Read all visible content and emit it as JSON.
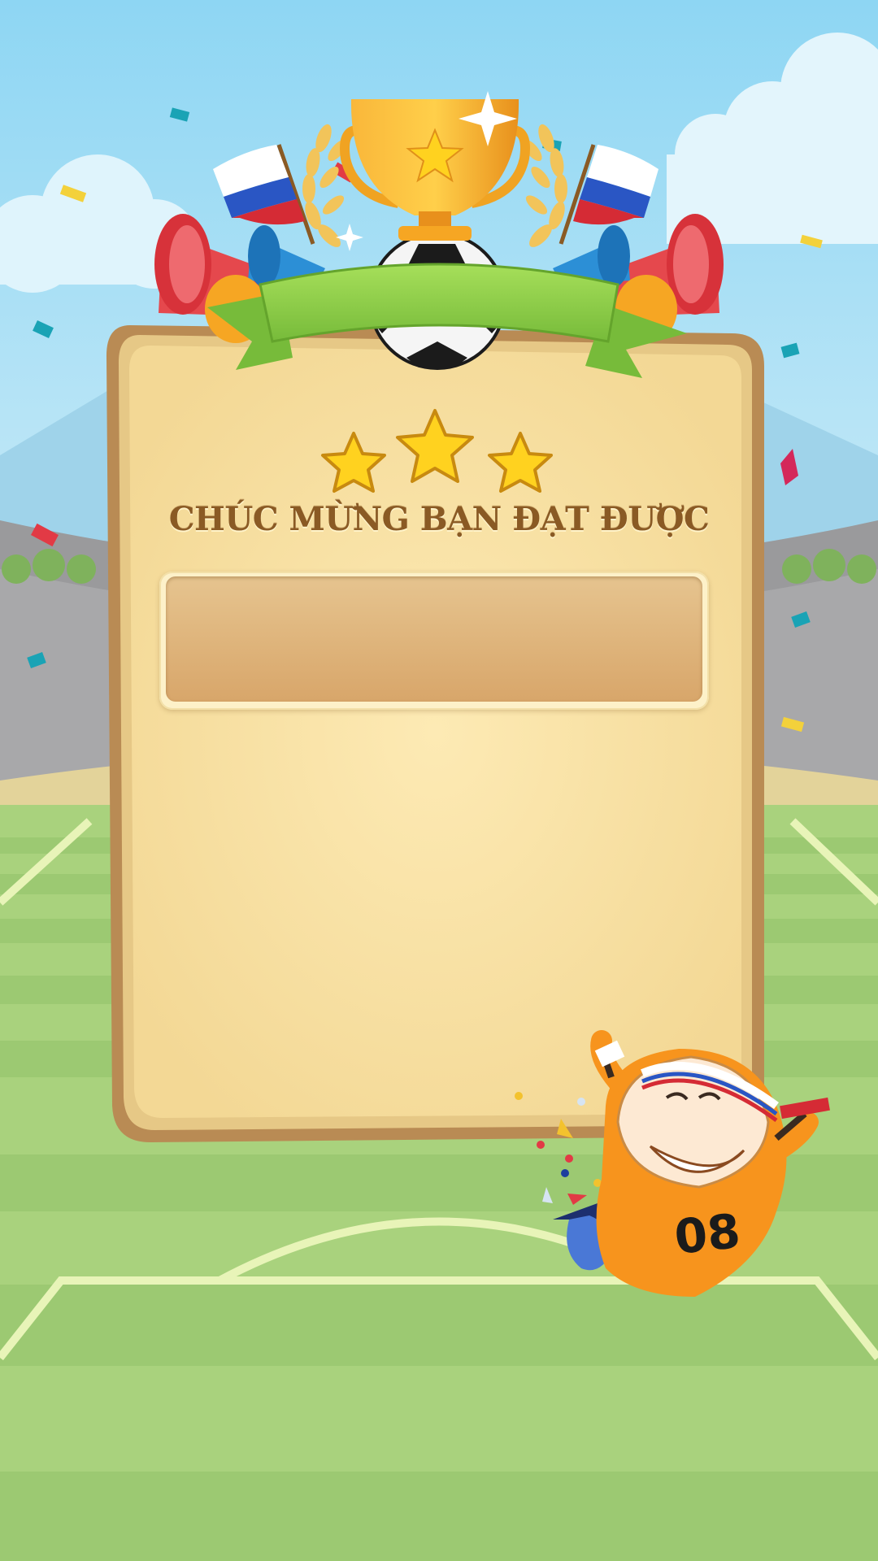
{
  "screen": {
    "title": "CHÚC MỪNG BẠN ĐẠT ĐƯỢC",
    "stars_earned": 3,
    "stars_total": 3,
    "reward_text": ""
  },
  "mascot": {
    "jersey_number": "08"
  },
  "icons": [
    "trophy-icon",
    "flag-icon",
    "star-icon",
    "soccer-ball-icon",
    "vuvuzela-icon"
  ],
  "colors": {
    "sky": "#8ed6f3",
    "pitch": "#a9d27d",
    "card": "#f8e2a6",
    "card_border": "#b98b54",
    "ribbon": "#8ccc4a",
    "title": "#8a5a24",
    "trophy": "#f6a623",
    "star": "#ffd21f",
    "jersey": "#f7941d"
  }
}
